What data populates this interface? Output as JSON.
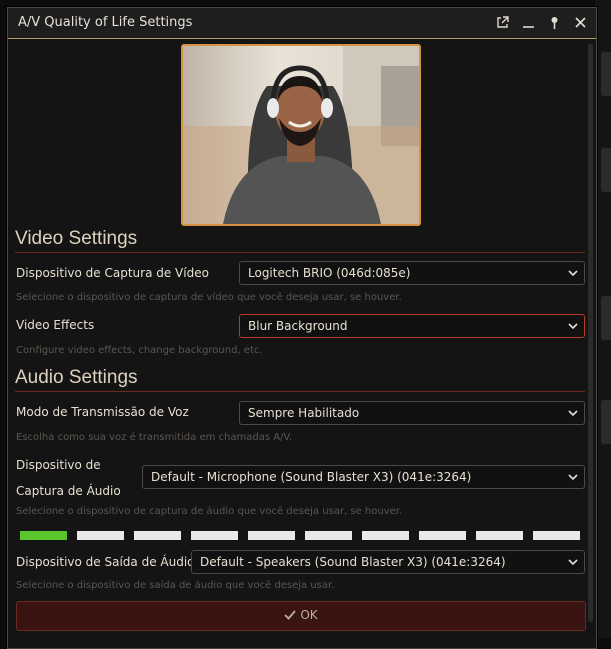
{
  "window": {
    "title": "A/V Quality of Life Settings"
  },
  "titlebar_icons": [
    "popout-icon",
    "minimize-icon",
    "pin-icon",
    "close-icon"
  ],
  "video": {
    "section_title": "Video Settings",
    "capture_device": {
      "label": "Dispositivo de Captura de Vídeo",
      "value": "Logitech BRIO (046d:085e)",
      "hint": "Selecione o dispositivo de captura de vídeo que você deseja usar, se houver."
    },
    "effects": {
      "label": "Video Effects",
      "value": "Blur Background",
      "hint": "Configure video effects, change background, etc."
    }
  },
  "audio": {
    "section_title": "Audio Settings",
    "transmission_mode": {
      "label": "Modo de Transmissão de Voz",
      "value": "Sempre Habilitado",
      "hint": "Escolha como sua voz é transmitida em chamadas A/V."
    },
    "capture_device": {
      "label_line1": "Dispositivo de",
      "label_line2": "Captura de Áudio",
      "value": "Default - Microphone (Sound Blaster X3) (041e:3264)",
      "hint": "Selecione o dispositivo de captura de áudio que você deseja usar, se houver."
    },
    "input_level": {
      "active_segments": 1,
      "total_segments": 10
    },
    "output_device": {
      "label": "Dispositivo de Saída de Áudio",
      "value": "Default - Speakers (Sound Blaster X3) (041e:3264)",
      "hint": "Selecione o dispositivo de saída de áudio que você deseja usar."
    }
  },
  "footer": {
    "ok_label": "OK",
    "ok_icon": "checkmark-icon"
  },
  "colors": {
    "accent_border": "#d49442",
    "focus_border": "#b63a2c",
    "meter_active": "#59c72c",
    "meter_inactive": "#e9e9e9",
    "ok_button_bg": "#3a1410"
  }
}
